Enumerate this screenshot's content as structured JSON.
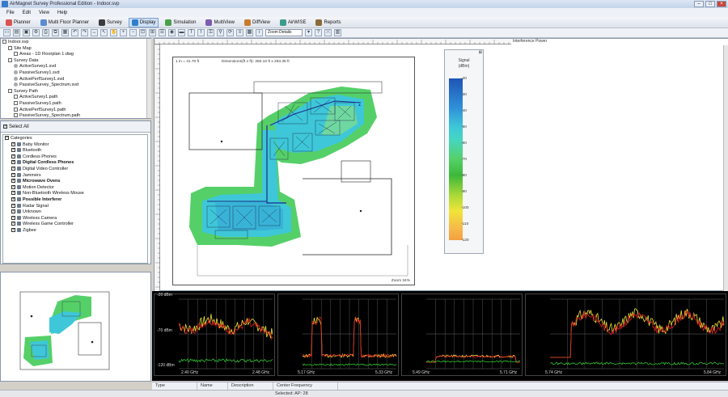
{
  "window": {
    "title": "AirMagnet Survey Professional Edition - Indoor.svp"
  },
  "menu": [
    "File",
    "Edit",
    "View",
    "Help"
  ],
  "toolbar": [
    {
      "label": "Planner",
      "icon": "planner-icon",
      "color": "#d9534f"
    },
    {
      "label": "Multi Floor Planner",
      "icon": "multi-floor-icon",
      "color": "#5b8bd0"
    },
    {
      "label": "Survey",
      "icon": "survey-icon",
      "color": "#3a3a3a"
    },
    {
      "label": "Display",
      "icon": "display-icon",
      "color": "#2f7ec9",
      "active": true
    },
    {
      "label": "Simulation",
      "icon": "simulation-icon",
      "color": "#4aa04a"
    },
    {
      "label": "MultiView",
      "icon": "multiview-icon",
      "color": "#7c5bb0"
    },
    {
      "label": "DiffView",
      "icon": "diffview-icon",
      "color": "#c97a2f"
    },
    {
      "label": "AirWISE",
      "icon": "airwise-icon",
      "color": "#3b9c8c"
    },
    {
      "label": "Reports",
      "icon": "reports-icon",
      "color": "#8a6a3a"
    }
  ],
  "toolbar2": {
    "zoom_combo": "Zoom Details"
  },
  "project_tree": {
    "items": [
      {
        "level": 0,
        "text": "Indoor.svp"
      },
      {
        "level": 1,
        "text": "Site Map"
      },
      {
        "level": 2,
        "text": "Areas - 1D Floorplan 1.dwg"
      },
      {
        "level": 1,
        "text": "Survey Data"
      },
      {
        "level": 2,
        "text": "ActiveSurvey1.svd"
      },
      {
        "level": 2,
        "text": "PassiveSurvey1.svd"
      },
      {
        "level": 2,
        "text": "ActivePerfSurvey1.svd"
      },
      {
        "level": 2,
        "text": "PassiveSurvey_Spectrum.svd"
      },
      {
        "level": 1,
        "text": "Survey Path"
      },
      {
        "level": 2,
        "text": "ActiveSurvey1.path"
      },
      {
        "level": 2,
        "text": "PassiveSurvey1.path"
      },
      {
        "level": 2,
        "text": "ActivePerfSurvey1.path"
      },
      {
        "level": 2,
        "text": "PassiveSurvey_Spectrum.path"
      }
    ]
  },
  "categories": {
    "select_all": "Select All",
    "header": "Categories",
    "items": [
      {
        "label": "Baby Monitor",
        "bold": false
      },
      {
        "label": "Bluetooth",
        "bold": false
      },
      {
        "label": "Cordless Phones",
        "bold": false
      },
      {
        "label": "Digital Cordless Phones",
        "bold": true
      },
      {
        "label": "Digital Video Controller",
        "bold": false
      },
      {
        "label": "Jammers",
        "bold": false
      },
      {
        "label": "Microwave Ovens",
        "bold": true
      },
      {
        "label": "Motion Detector",
        "bold": false
      },
      {
        "label": "Non-Bluetooth Wireless Mouse",
        "bold": false
      },
      {
        "label": "Possible Interferer",
        "bold": true
      },
      {
        "label": "Radar Signal",
        "bold": false
      },
      {
        "label": "Unknown",
        "bold": false
      },
      {
        "label": "Wireless Camera",
        "bold": false
      },
      {
        "label": "Wireless Game Controller",
        "bold": false
      },
      {
        "label": "Zigbee",
        "bold": false
      }
    ]
  },
  "map": {
    "scale_text": "1 in = 41.70 ft",
    "dimensions_text": "Dimensions(ft x ft): 250.10 ft x 263.35 ft",
    "zoom_text": "Zoom 34%"
  },
  "legend": {
    "title_line1": "Signal",
    "title_line2": "(dBm)",
    "ticks": [
      "-20",
      "-30",
      "-40",
      "-50",
      "-60",
      "-70",
      "-80",
      "-90",
      "-100",
      "-110",
      "-120"
    ]
  },
  "info_panel": {
    "label": "Interference Power"
  },
  "spectrum": {
    "panels": [
      {
        "left_label": "2.40 GHz",
        "right_label": "2.48 GHz",
        "top": "-20 dBm",
        "mid": "-70 dBm",
        "bot": "-120 dBm"
      },
      {
        "left_label": "5.17 GHz",
        "right_label": "5.33 GHz"
      },
      {
        "left_label": "5.49 GHz",
        "right_label": "5.71 GHz"
      },
      {
        "left_label": "5.74 GHz",
        "right_label": "5.84 GHz"
      }
    ]
  },
  "table": {
    "columns": [
      "Type",
      "Name",
      "Description",
      "Center Frequency"
    ]
  },
  "status": {
    "text": "Selected: AP: 28"
  }
}
